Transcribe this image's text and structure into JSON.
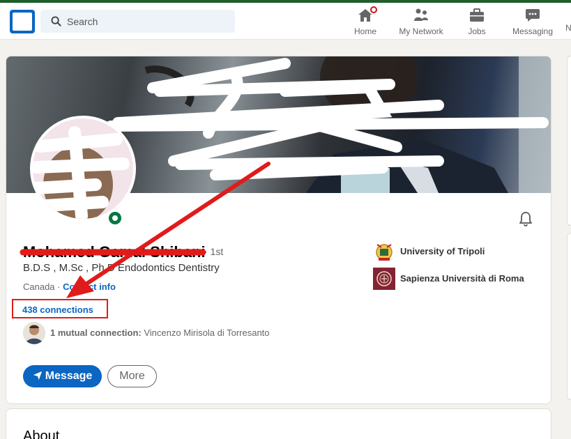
{
  "navbar": {
    "search_placeholder": "Search",
    "items": [
      {
        "label": "Home",
        "icon": "home-icon"
      },
      {
        "label": "My Network",
        "icon": "network-icon"
      },
      {
        "label": "Jobs",
        "icon": "briefcase-icon"
      },
      {
        "label": "Messaging",
        "icon": "messaging-icon"
      }
    ],
    "cut_off_label": "N"
  },
  "profile": {
    "name": "Mohamed Gamal Shibani",
    "degree": "· 1st",
    "headline": "B.D.S , M.Sc , Ph.D Endodontics Dentistry",
    "location": "Canada",
    "contact_sep": " · ",
    "contact_info": "Contact info",
    "connections": "438 connections",
    "mutual_label": "1 mutual connection:",
    "mutual_name": "Vincenzo Mirisola di Torresanto",
    "message_button": "Message",
    "more_button": "More"
  },
  "education": [
    {
      "name": "University of Tripoli"
    },
    {
      "name": "Sapienza Università di Roma"
    }
  ],
  "about": {
    "title": "About"
  },
  "colors": {
    "brand": "#0a66c2",
    "annotation": "#e01b1b",
    "online": "#057642",
    "notification": "#cc1016"
  }
}
